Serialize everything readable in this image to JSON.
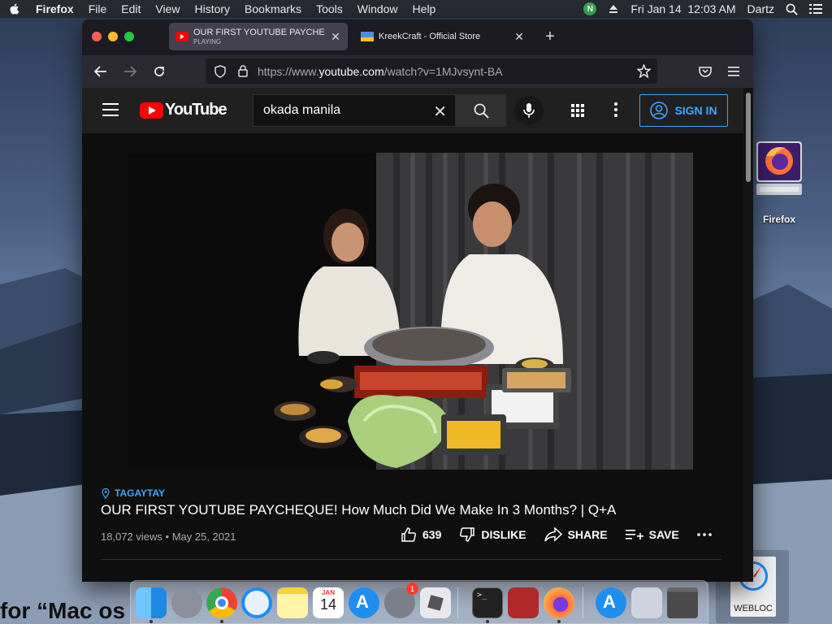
{
  "menubar": {
    "app_name": "Firefox",
    "items": [
      "File",
      "Edit",
      "View",
      "History",
      "Bookmarks",
      "Tools",
      "Window",
      "Help"
    ],
    "n_badge": "N",
    "datetime": "Fri Jan 14  12:03 AM",
    "user": "Dartz"
  },
  "desktop": {
    "firefox_icon_label": "Firefox",
    "webloc_label": "WEBLOC",
    "partial_text": "for “Mac os"
  },
  "browser": {
    "tabs": [
      {
        "title": "OUR FIRST YOUTUBE PAYCHE",
        "status": "PLAYING"
      },
      {
        "title": "KreekCraft - Official Store"
      }
    ],
    "url_prefix": "https://www.",
    "url_domain": "youtube.com",
    "url_path": "/watch?v=1MJvsynt-BA"
  },
  "youtube": {
    "logo_text": "YouTube",
    "search_query": "okada manila",
    "sign_in_label": "SIGN IN",
    "location": "TAGAYTAY",
    "video_title": "OUR FIRST YOUTUBE PAYCHEQUE! How Much Did We Make In 3 Months? | Q+A",
    "views": "18,072 views",
    "date": "May 25, 2021",
    "likes": "639",
    "dislike_label": "DISLIKE",
    "share_label": "SHARE",
    "save_label": "SAVE"
  },
  "dock": {
    "calendar_month": "JAN",
    "calendar_day": "14",
    "settings_badge": "1"
  }
}
